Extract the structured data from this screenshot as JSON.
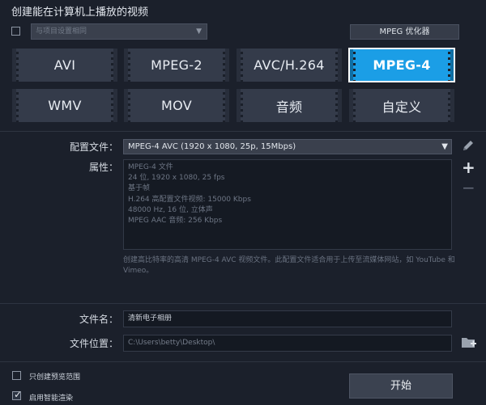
{
  "header": {
    "title": "创建能在计算机上播放的视频"
  },
  "device_filter": {
    "checked": false,
    "dropdown_value": "与项目设置相同"
  },
  "mpeg_optimizer": {
    "label": "MPEG 优化器"
  },
  "formats": [
    {
      "label": "AVI",
      "active": false
    },
    {
      "label": "MPEG-2",
      "active": false
    },
    {
      "label": "AVC/H.264",
      "active": false
    },
    {
      "label": "MPEG-4",
      "active": true
    },
    {
      "label": "WMV",
      "active": false
    },
    {
      "label": "MOV",
      "active": false
    },
    {
      "label": "音频",
      "active": false
    },
    {
      "label": "自定义",
      "active": false
    }
  ],
  "profile": {
    "label": "配置文件：",
    "value": "MPEG-4 AVC (1920 x 1080, 25p, 15Mbps)"
  },
  "properties": {
    "label": "属性：",
    "lines": [
      "MPEG-4 文件",
      "24 位, 1920 x 1080, 25 fps",
      "基于帧",
      "H.264 高配置文件视频: 15000 Kbps",
      "48000 Hz, 16 位, 立体声",
      "MPEG AAC 音频: 256 Kbps"
    ]
  },
  "description": "创建高比特率的高清 MPEG-4 AVC 视频文件。此配置文件适合用于上传至流媒体网站，如 YouTube 和 Vimeo。",
  "file_name": {
    "label": "文件名：",
    "value": "清新电子相册"
  },
  "file_location": {
    "label": "文件位置：",
    "value": "C:\\Users\\betty\\Desktop\\"
  },
  "options": {
    "preview_only": {
      "label": "只创建预览范围",
      "checked": false
    },
    "smart_render": {
      "label": "启用智能渲染",
      "checked": true
    }
  },
  "start_button": {
    "label": "开始"
  }
}
